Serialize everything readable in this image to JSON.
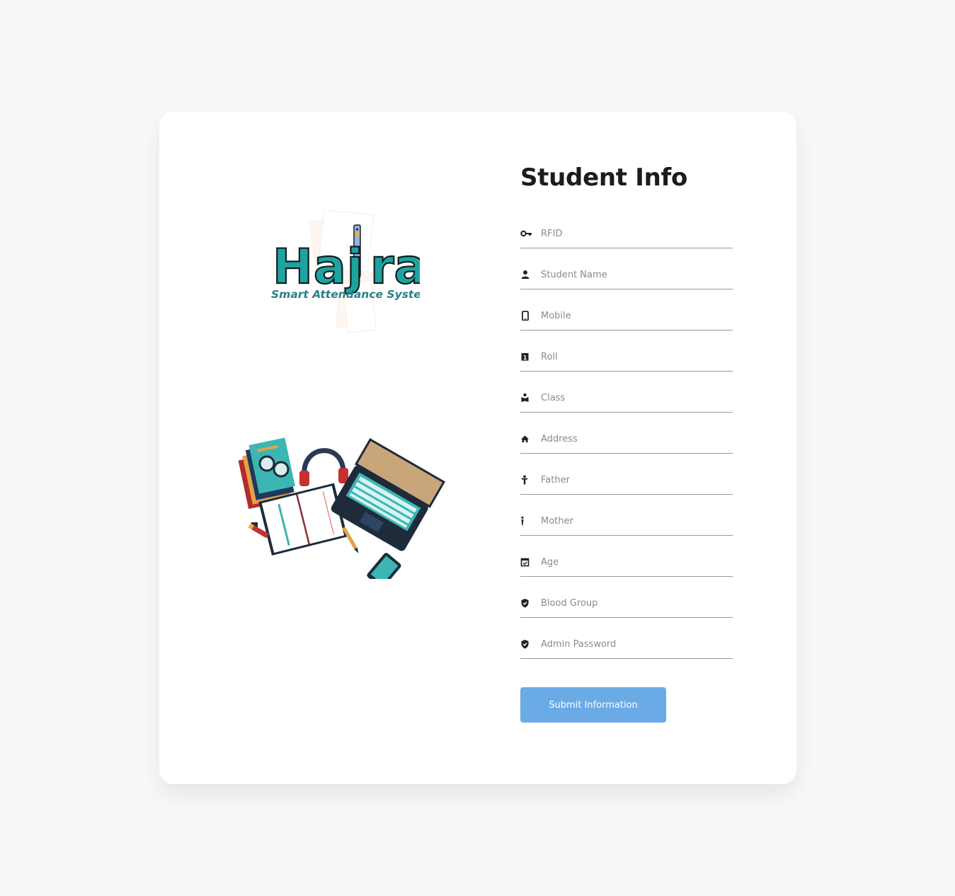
{
  "logo": {
    "name": "Hajira",
    "tagline": "Smart Attendance System"
  },
  "form": {
    "title": "Student Info",
    "fields": [
      {
        "icon": "key-icon",
        "placeholder": "RFID"
      },
      {
        "icon": "user-icon",
        "placeholder": "Student Name"
      },
      {
        "icon": "mobile-icon",
        "placeholder": "Mobile"
      },
      {
        "icon": "roll-number-icon",
        "placeholder": "Roll"
      },
      {
        "icon": "book-reader-icon",
        "placeholder": "Class"
      },
      {
        "icon": "home-icon",
        "placeholder": "Address"
      },
      {
        "icon": "male-icon",
        "placeholder": "Father"
      },
      {
        "icon": "female-icon",
        "placeholder": "Mother"
      },
      {
        "icon": "calendar-check-icon",
        "placeholder": "Age"
      },
      {
        "icon": "shield-check-icon",
        "placeholder": "Blood Group"
      },
      {
        "icon": "shield-check-icon",
        "placeholder": "Admin Password"
      }
    ],
    "submit_label": "Submit Information"
  },
  "colors": {
    "background": "#f8f8f8",
    "card": "#ffffff",
    "button": "#6aabe6",
    "title": "#1c1c1c",
    "logo_teal": "#1fa3a0"
  }
}
